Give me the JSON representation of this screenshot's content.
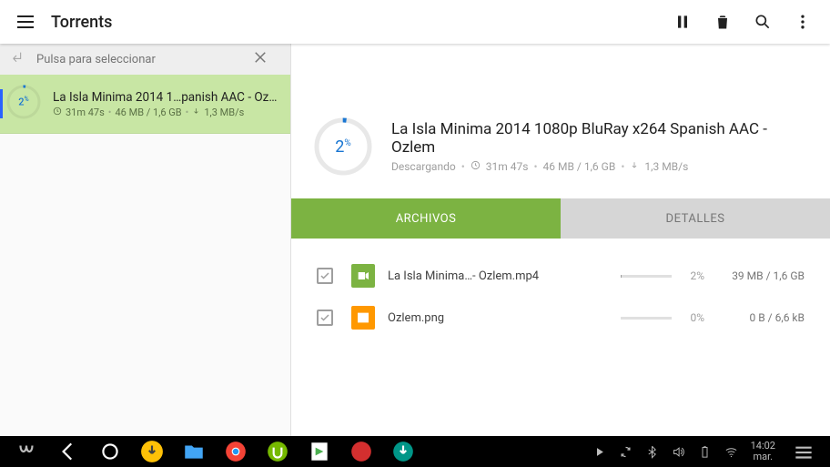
{
  "appbar": {
    "title": "Torrents"
  },
  "selection_bar": {
    "hint": "Pulsa para seleccionar"
  },
  "torrents": [
    {
      "percent": 2,
      "name": "La Isla Minima 2014 1…panish AAC - Ozlem",
      "eta": "31m 47s",
      "size": "46 MB / 1,6 GB",
      "speed": "1,3 MB/s"
    }
  ],
  "detail": {
    "percent": 2,
    "name": "La Isla Minima 2014 1080p BluRay x264 Spanish AAC - Ozlem",
    "status": "Descargando",
    "eta": "31m 47s",
    "size": "46 MB / 1,6 GB",
    "speed": "1,3 MB/s",
    "tabs": {
      "files": "ARCHIVOS",
      "details": "DETALLES"
    },
    "files": [
      {
        "type": "video",
        "name": "La Isla Minima…- Ozlem.mp4",
        "percent": 2,
        "percent_label": "2%",
        "size": "39 MB / 1,6 GB",
        "checked": true
      },
      {
        "type": "image",
        "name": "Ozlem.png",
        "percent": 0,
        "percent_label": "0%",
        "size": "0 B / 6,6 kB",
        "checked": true
      }
    ]
  },
  "taskbar": {
    "time": "14:02",
    "day": "mar."
  }
}
